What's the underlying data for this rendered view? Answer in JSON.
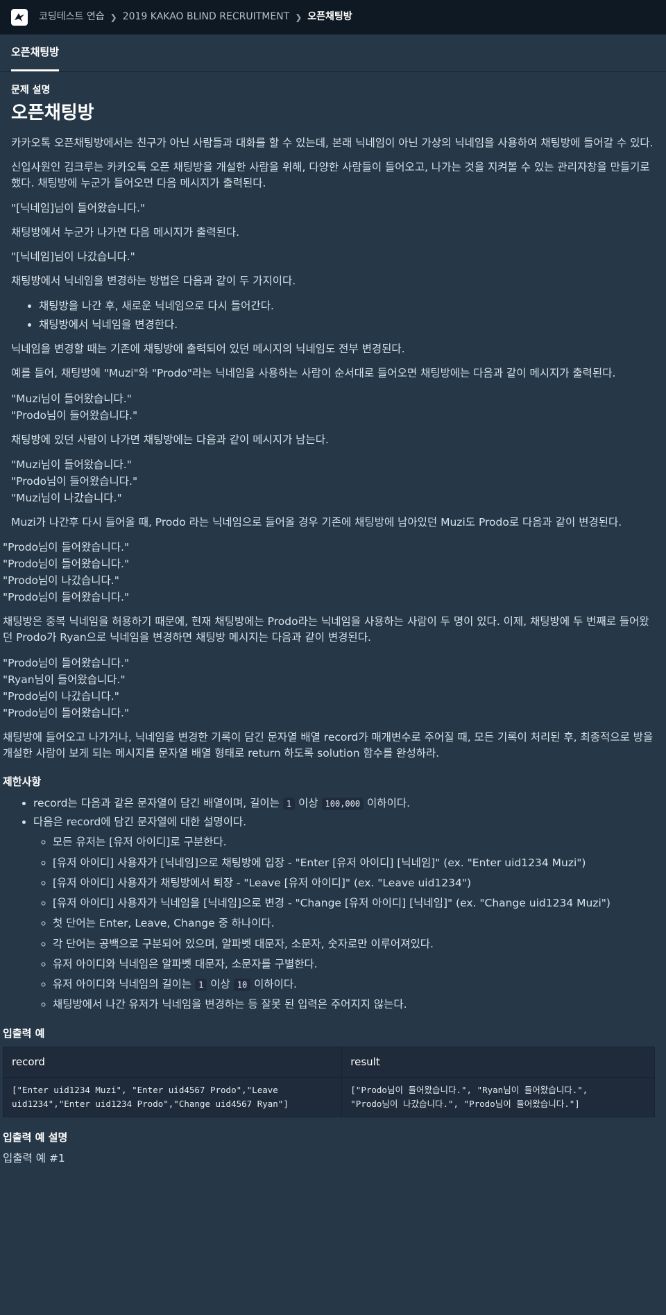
{
  "topbar": {
    "breadcrumbs": [
      "코딩테스트 연습",
      "2019 KAKAO BLIND RECRUITMENT",
      "오픈채팅방"
    ]
  },
  "tab": {
    "label": "오픈채팅방"
  },
  "problem": {
    "section_label": "문제 설명",
    "title": "오픈채팅방",
    "p1": "카카오톡 오픈채팅방에서는 친구가 아닌 사람들과 대화를 할 수 있는데, 본래 닉네임이 아닌 가상의 닉네임을 사용하여 채팅방에 들어갈 수 있다.",
    "p2": "신입사원인 김크루는 카카오톡 오픈 채팅방을 개설한 사람을 위해, 다양한 사람들이 들어오고, 나가는 것을 지켜볼 수 있는 관리자창을 만들기로 했다. 채팅방에 누군가 들어오면 다음 메시지가 출력된다.",
    "q_enter": "\"[닉네임]님이 들어왔습니다.\"",
    "p3": "채팅방에서 누군가 나가면 다음 메시지가 출력된다.",
    "q_leave": "\"[닉네임]님이 나갔습니다.\"",
    "p4": "채팅방에서 닉네임을 변경하는 방법은 다음과 같이 두 가지이다.",
    "methods": [
      "채팅방을 나간 후, 새로운 닉네임으로 다시 들어간다.",
      "채팅방에서 닉네임을 변경한다."
    ],
    "p5": "닉네임을 변경할 때는 기존에 채팅방에 출력되어 있던 메시지의 닉네임도 전부 변경된다.",
    "p6": "예를 들어, 채팅방에 \"Muzi\"와 \"Prodo\"라는 닉네임을 사용하는 사람이 순서대로 들어오면 채팅방에는 다음과 같이 메시지가 출력된다.",
    "ex1": [
      "\"Muzi님이 들어왔습니다.\"",
      "\"Prodo님이 들어왔습니다.\""
    ],
    "p7": "채팅방에 있던 사람이 나가면 채팅방에는 다음과 같이 메시지가 남는다.",
    "ex2": [
      "\"Muzi님이 들어왔습니다.\"",
      "\"Prodo님이 들어왔습니다.\"",
      "\"Muzi님이 나갔습니다.\""
    ],
    "p8": "Muzi가 나간후 다시 들어올 때, Prodo 라는 닉네임으로 들어올 경우 기존에 채팅방에 남아있던 Muzi도 Prodo로 다음과 같이 변경된다.",
    "ex3": [
      "\"Prodo님이 들어왔습니다.\"",
      "\"Prodo님이 들어왔습니다.\"",
      "\"Prodo님이 나갔습니다.\"",
      "\"Prodo님이 들어왔습니다.\""
    ],
    "p9": "채팅방은 중복 닉네임을 허용하기 때문에, 현재 채팅방에는 Prodo라는 닉네임을 사용하는 사람이 두 명이 있다. 이제, 채팅방에 두 번째로 들어왔던 Prodo가 Ryan으로 닉네임을 변경하면 채팅방 메시지는 다음과 같이 변경된다.",
    "ex4": [
      "\"Prodo님이 들어왔습니다.\"",
      "\"Ryan님이 들어왔습니다.\"",
      "\"Prodo님이 나갔습니다.\"",
      "\"Prodo님이 들어왔습니다.\""
    ],
    "p10": "채팅방에 들어오고 나가거나, 닉네임을 변경한 기록이 담긴 문자열 배열 record가 매개변수로 주어질 때, 모든 기록이 처리된 후, 최종적으로 방을 개설한 사람이 보게 되는 메시지를 문자열 배열 형태로 return 하도록 solution 함수를 완성하라."
  },
  "constraints": {
    "heading": "제한사항",
    "item1_pre": "record는 다음과 같은 문자열이 담긴 배열이며, 길이는",
    "item1_code1": "1",
    "item1_mid": "이상",
    "item1_code2": "100,000",
    "item1_post": "이하이다.",
    "item2": "다음은 record에 담긴 문자열에 대한 설명이다.",
    "sub": [
      "모든 유저는 [유저 아이디]로 구분한다.",
      "[유저 아이디] 사용자가 [닉네임]으로 채팅방에 입장 - \"Enter [유저 아이디] [닉네임]\" (ex. \"Enter uid1234 Muzi\")",
      "[유저 아이디] 사용자가 채팅방에서 퇴장 - \"Leave [유저 아이디]\" (ex. \"Leave uid1234\")",
      "[유저 아이디] 사용자가 닉네임을 [닉네임]으로 변경 - \"Change [유저 아이디] [닉네임]\" (ex. \"Change uid1234 Muzi\")",
      "첫 단어는 Enter, Leave, Change 중 하나이다.",
      "각 단어는 공백으로 구분되어 있으며, 알파벳 대문자, 소문자, 숫자로만 이루어져있다.",
      "유저 아이디와 닉네임은 알파벳 대문자, 소문자를 구별한다."
    ],
    "len_pre": "유저 아이디와 닉네임의 길이는",
    "len_code1": "1",
    "len_mid": "이상",
    "len_code2": "10",
    "len_post": "이하이다.",
    "last": "채팅방에서 나간 유저가 닉네임을 변경하는 등 잘못 된 입력은 주어지지 않는다."
  },
  "io_example": {
    "heading": "입출력 예",
    "col_record": "record",
    "col_result": "result",
    "record_line1": "[\"Enter uid1234 Muzi\", \"Enter uid4567 Prodo\",\"Leave",
    "record_line2": "uid1234\",\"Enter uid1234 Prodo\",\"Change uid4567 Ryan\"]",
    "result_line1": "[\"Prodo님이 들어왔습니다.\", \"Ryan님이 들어왔습니다.\",",
    "result_line2": "\"Prodo님이 나갔습니다.\", \"Prodo님이 들어왔습니다.\"]"
  },
  "io_explain": {
    "heading": "입출력 예 설명",
    "ex_label": "입출력 예 #1"
  }
}
